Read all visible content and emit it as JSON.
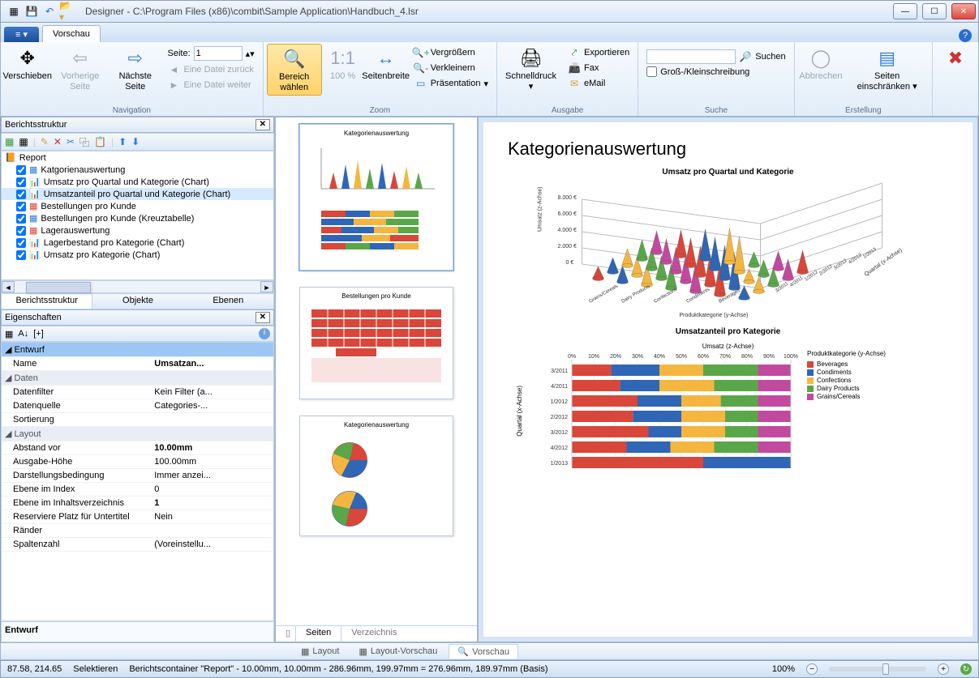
{
  "title": "Designer - C:\\Program Files (x86)\\combit\\Sample Application\\Handbuch_4.lsr",
  "qat_icons": [
    "menu",
    "save",
    "undo",
    "open"
  ],
  "ribbon": {
    "file": "",
    "tab": "Vorschau",
    "groups": {
      "nav": {
        "label": "Navigation",
        "verschieben": "Verschieben",
        "vorherige": "Vorherige Seite",
        "naechste": "Nächste Seite",
        "seite_label": "Seite:",
        "seite_value": "1",
        "datei_zurueck": "Eine Datei zurück",
        "datei_weiter": "Eine Datei weiter"
      },
      "zoom": {
        "label": "Zoom",
        "bereich": "Bereich wählen",
        "hundert": "100 %",
        "seitenbreite": "Seitenbreite",
        "vergroessern": "Vergrößern",
        "verkleinern": "Verkleinern",
        "praesentation": "Präsentation"
      },
      "ausgabe": {
        "label": "Ausgabe",
        "schnelldruck": "Schnelldruck",
        "exportieren": "Exportieren",
        "fax": "Fax",
        "email": "eMail"
      },
      "suche": {
        "label": "Suche",
        "suchen": "Suchen",
        "gross": "Groß-/Kleinschreibung"
      },
      "erstellung": {
        "label": "Erstellung",
        "abbrechen": "Abbrechen",
        "seiten": "Seiten einschränken"
      },
      "schliessen": "Druckvorschau schließen"
    }
  },
  "structPanel": {
    "title": "Berichtsstruktur",
    "root": "Report",
    "items": [
      "Katgorienauswertung",
      "Umsatz pro Quartal und Kategorie (Chart)",
      "Umsatzanteil pro Quartal und Kategorie (Chart)",
      "Bestellungen pro Kunde",
      "Bestellungen pro Kunde (Kreuztabelle)",
      "Lagerauswertung",
      "Lagerbestand pro Kategorie (Chart)",
      "Umsatz pro Kategorie (Chart)"
    ],
    "selectedIndex": 2,
    "tabs": [
      "Berichtsstruktur",
      "Objekte",
      "Ebenen"
    ]
  },
  "propsPanel": {
    "title": "Eigenschaften",
    "entwurf": "Entwurf",
    "rows": [
      {
        "k": "Name",
        "v": "Umsatzan...",
        "bold": true
      },
      {
        "cat": "Daten"
      },
      {
        "k": "Datenfilter",
        "v": "Kein Filter (a..."
      },
      {
        "k": "Datenquelle",
        "v": "Categories-..."
      },
      {
        "k": "Sortierung",
        "v": ""
      },
      {
        "cat": "Layout"
      },
      {
        "k": "Abstand vor",
        "v": "10.00mm",
        "bold": true
      },
      {
        "k": "Ausgabe-Höhe",
        "v": "100.00mm"
      },
      {
        "k": "Darstellungsbedingung",
        "v": "Immer anzei..."
      },
      {
        "k": "Ebene im Index",
        "v": "0"
      },
      {
        "k": "Ebene im Inhaltsverzeichnis",
        "v": "1",
        "bold": true
      },
      {
        "k": "Reserviere Platz für Untertitel",
        "v": "Nein"
      },
      {
        "k": "Ränder",
        "v": ""
      },
      {
        "k": "Spaltenzahl",
        "v": "(Voreinstellu..."
      }
    ],
    "footer": "Entwurf"
  },
  "thumbs": {
    "pages": [
      {
        "title": "Kategorienauswertung",
        "kind": "cones+bars"
      },
      {
        "title": "Bestellungen pro Kunde",
        "kind": "table"
      },
      {
        "title": "Kategorienauswertung",
        "kind": "pies"
      }
    ],
    "tabs": [
      "Seiten",
      "Verzeichnis"
    ]
  },
  "preview": {
    "h1": "Kategorienauswertung",
    "chart1_title": "Umsatz pro Quartal und Kategorie",
    "chart1_xaxis": "Quartal (x-Achse)",
    "chart1_yaxis": "Produktkategorie (y-Achse)",
    "chart1_zaxis": "Umsatz (z-Achse)",
    "chart2_title": "Umsatzanteil pro Kategorie",
    "chart2_xaxis": "Umsatz (z-Achse)",
    "chart2_yaxis": "Quartal (x-Achse)",
    "chart2_legend_title": "Produktkategorie (y-Achse)"
  },
  "chart_data": [
    {
      "type": "area",
      "title": "Umsatz pro Quartal und Kategorie",
      "x_categories": [
        "3/2011",
        "4/2011",
        "1/2012",
        "2/2012",
        "3/2012",
        "4/2012",
        "1/2013"
      ],
      "y_categories": [
        "Grains/Cereals",
        "Dairy Products",
        "Confections",
        "Condiments",
        "Beverages"
      ],
      "zlabel": "Umsatz (z-Achse)",
      "z_ticks": [
        "0 €",
        "2.000 €",
        "4.000 €",
        "6.000 €",
        "8.000 €"
      ]
    },
    {
      "type": "bar",
      "title": "Umsatzanteil pro Kategorie",
      "categories": [
        "3/2011",
        "4/2011",
        "1/2012",
        "2/2012",
        "3/2012",
        "4/2012",
        "1/2013"
      ],
      "xlabel": "Umsatz (z-Achse)",
      "x_ticks": [
        "0%",
        "10%",
        "20%",
        "30%",
        "40%",
        "50%",
        "60%",
        "70%",
        "80%",
        "90%",
        "100%"
      ],
      "legend": [
        "Beverages",
        "Condiments",
        "Confections",
        "Dairy Products",
        "Grains/Cereals"
      ],
      "colors": [
        "#d9463a",
        "#2f66b5",
        "#f4b63f",
        "#5aa749",
        "#c24a9e"
      ],
      "series": [
        {
          "name": "Beverages",
          "values": [
            18,
            22,
            30,
            28,
            35,
            25,
            60
          ]
        },
        {
          "name": "Condiments",
          "values": [
            22,
            18,
            20,
            22,
            15,
            20,
            40
          ]
        },
        {
          "name": "Confections",
          "values": [
            20,
            25,
            18,
            20,
            20,
            20,
            0
          ]
        },
        {
          "name": "Dairy Products",
          "values": [
            25,
            20,
            17,
            15,
            15,
            20,
            0
          ]
        },
        {
          "name": "Grains/Cereals",
          "values": [
            15,
            15,
            15,
            15,
            15,
            15,
            0
          ]
        }
      ]
    }
  ],
  "viewTabs": [
    "Layout",
    "Layout-Vorschau",
    "Vorschau"
  ],
  "status": {
    "coords": "87.58, 214.65",
    "mode": "Selektieren",
    "info": "Berichtscontainer \"Report\"  -  10.00mm, 10.00mm  -  286.96mm, 199.97mm  =  276.96mm, 189.97mm (Basis)",
    "zoom": "100%"
  }
}
